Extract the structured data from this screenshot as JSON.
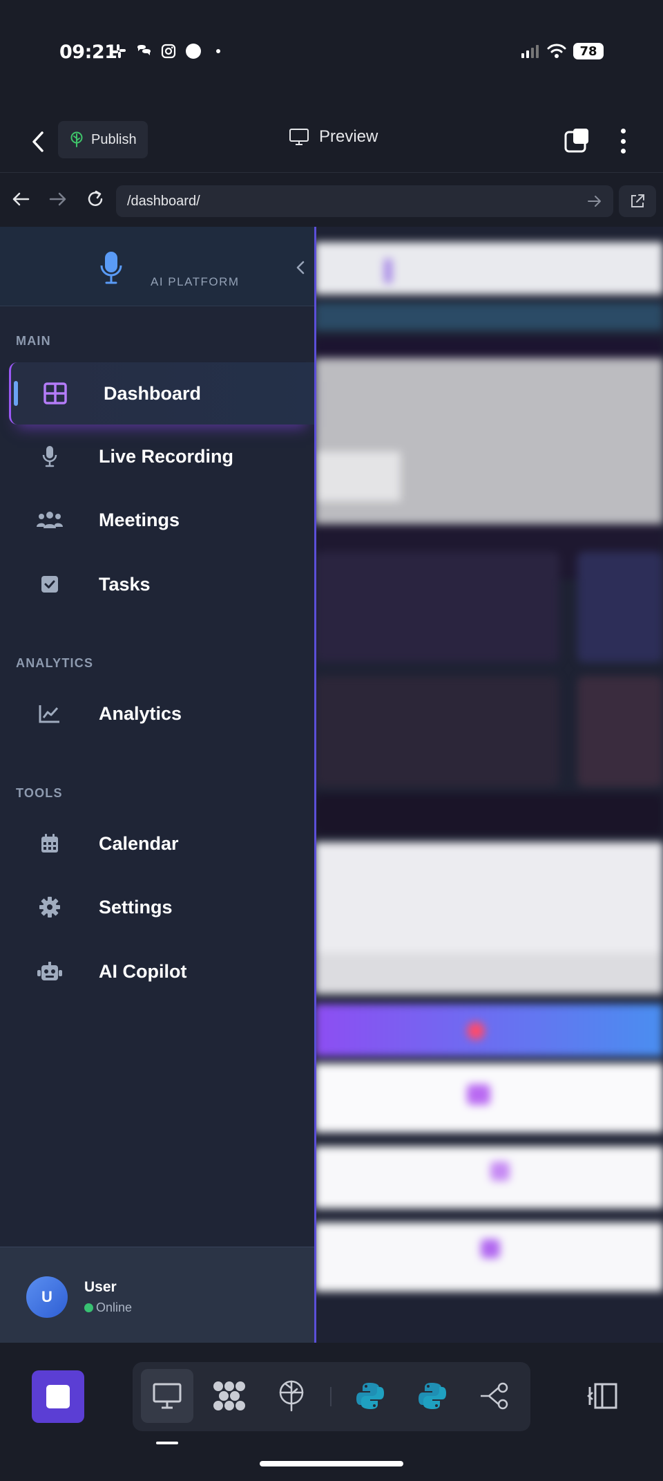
{
  "status_bar": {
    "time": "09:21",
    "battery": "78"
  },
  "top_bar": {
    "publish_label": "Publish",
    "preview_label": "Preview"
  },
  "url_bar": {
    "url": "/dashboard/"
  },
  "sidebar": {
    "brand": "AI PLATFORM",
    "sections": {
      "main": "MAIN",
      "analytics": "ANALYTICS",
      "tools": "TOOLS"
    },
    "items": [
      {
        "label": "Dashboard",
        "icon": "dashboard-grid-icon",
        "active": true
      },
      {
        "label": "Live Recording",
        "icon": "microphone-icon"
      },
      {
        "label": "Meetings",
        "icon": "users-icon"
      },
      {
        "label": "Tasks",
        "icon": "checkbox-icon"
      },
      {
        "label": "Analytics",
        "icon": "line-chart-icon"
      },
      {
        "label": "Calendar",
        "icon": "calendar-icon"
      },
      {
        "label": "Settings",
        "icon": "gear-icon"
      },
      {
        "label": "AI Copilot",
        "icon": "robot-icon"
      }
    ],
    "user": {
      "initial": "U",
      "name": "User",
      "status": "Online"
    }
  },
  "colors": {
    "accent_purple": "#9a58f5",
    "active_bar_blue": "#6ba3f3",
    "sidebar_bg": "#1f2536",
    "online_green": "#38c172",
    "stop_button": "#5b3ed4"
  }
}
